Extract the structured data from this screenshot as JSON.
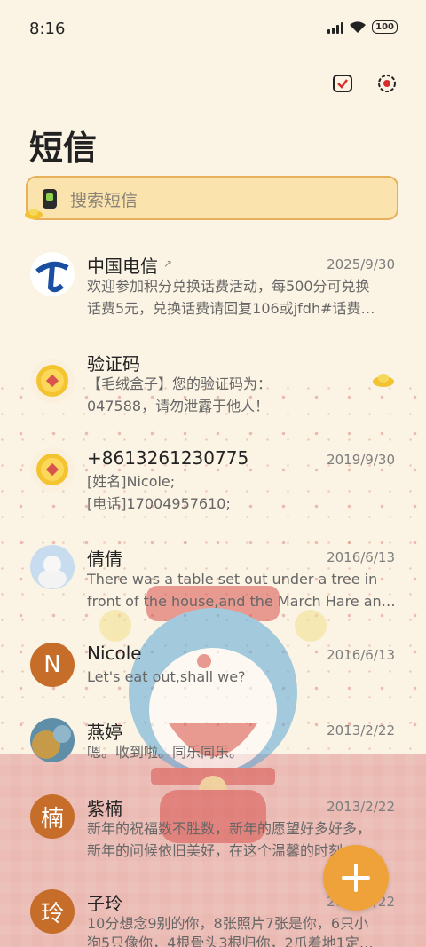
{
  "status": {
    "time": "8:16",
    "battery": "100"
  },
  "header": {
    "title": "短信"
  },
  "search": {
    "placeholder": "搜索短信"
  },
  "conversations": [
    {
      "name": "中国电信",
      "date": "2025/9/30",
      "line1": "欢迎参加积分兑换话费活动，每500分可兑换",
      "line2": "话费5元，兑换话费请回复106或jfdh#话费…"
    },
    {
      "name": "验证码",
      "date": "",
      "line1": "【毛绒盒子】您的验证码为：",
      "line2": "047588，请勿泄露于他人！"
    },
    {
      "name": "+8613261230775",
      "date": "2019/9/30",
      "line1": "[姓名]Nicole;",
      "line2": "[电话]17004957610;"
    },
    {
      "name": "倩倩",
      "date": "2016/6/13",
      "line1": "There was a table set out under a tree in",
      "line2": "front of the house,and the March Hare an…"
    },
    {
      "name": "Nicole",
      "date": "2016/6/13",
      "line1": "Let's eat out,shall we?",
      "line2": "",
      "avatar_letter": "N"
    },
    {
      "name": "燕婷",
      "date": "2013/2/22",
      "line1": "嗯。收到啦。同乐同乐。",
      "line2": ""
    },
    {
      "name": "紫楠",
      "date": "2013/2/22",
      "line1": "新年的祝福数不胜数，新年的愿望好多好多，",
      "line2": "新年的问候依旧美好，在这个温馨的时刻…",
      "avatar_letter": "楠"
    },
    {
      "name": "子玲",
      "date": "2013/2/22",
      "line1": "10分想念9别的你，8张照片7张是你，6只小",
      "line2": "狗5只像你，4根骨头3根归你，2爪着地1定…",
      "avatar_letter": "玲"
    }
  ],
  "colors": {
    "accent": "#efa23a",
    "background": "#fbf3e3",
    "search_bg": "#fbe3ad"
  }
}
